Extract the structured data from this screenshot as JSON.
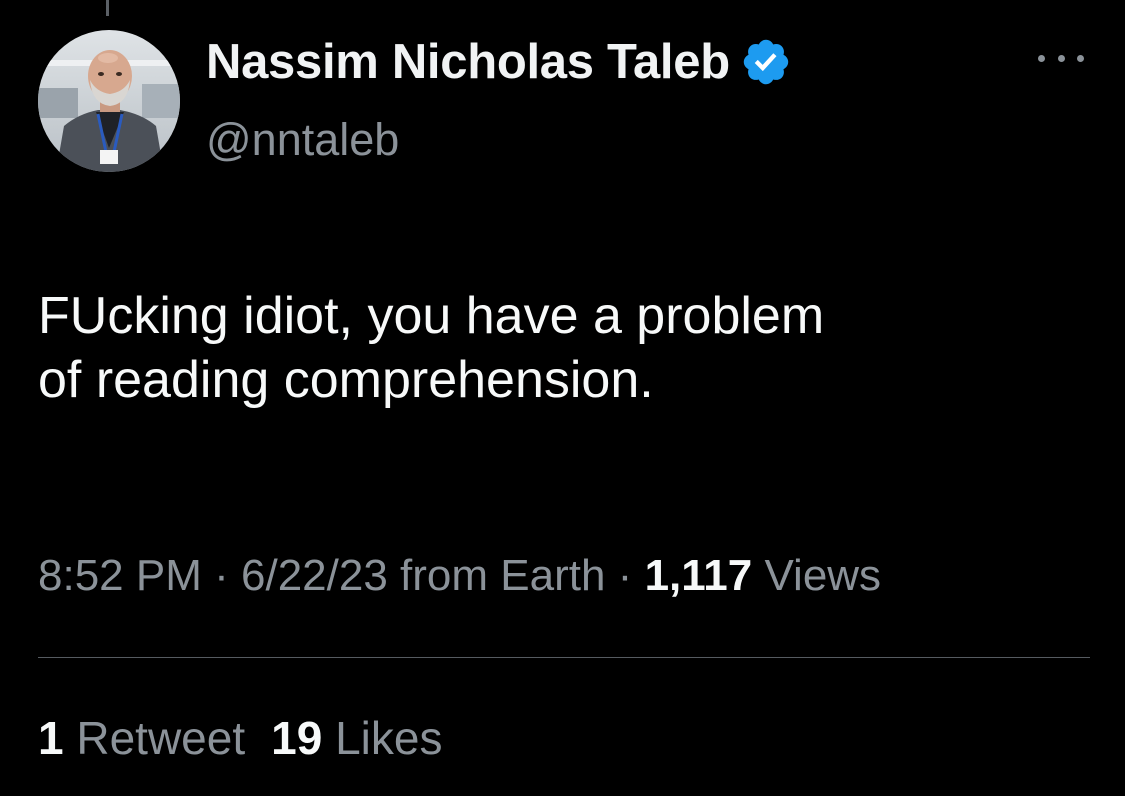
{
  "author": {
    "display_name": "Nassim Nicholas Taleb",
    "handle": "@nntaleb",
    "verified": true,
    "verified_color": "#1d9bf0"
  },
  "tweet": {
    "text": "FUcking idiot, you have a problem\nof reading comprehension."
  },
  "meta": {
    "time": "8:52 PM",
    "separator": "·",
    "date": "6/22/23",
    "source": "from Earth",
    "views_count": "1,117",
    "views_label": "Views"
  },
  "stats": {
    "retweets_count": "1",
    "retweets_label": "Retweet",
    "likes_count": "19",
    "likes_label": "Likes"
  },
  "colors": {
    "background": "#000000",
    "primary_text": "#f7f9f9",
    "secondary_text": "#8b9299",
    "divider": "#565b60"
  },
  "icons": {
    "more": "more-dots-icon",
    "verified": "verified-badge-icon"
  }
}
